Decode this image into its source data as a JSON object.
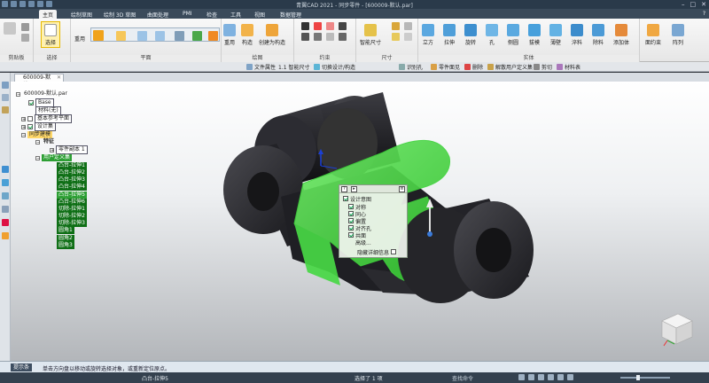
{
  "window": {
    "title": "青翼CAD 2021 - 同步零件 - [600009-默认.par]"
  },
  "menu": {
    "tabs": [
      "主页",
      "绘制草图",
      "绘制 3D 草图",
      "曲面处理",
      "PMI",
      "检查",
      "工具",
      "视图",
      "数据管理"
    ],
    "active_index": 0
  },
  "ribbon": {
    "groups": {
      "clipboard": "剪贴板",
      "select": "选择",
      "plane": "平面",
      "sketch": "绘图",
      "relate": "约束",
      "dimension": "尺寸",
      "solid": "实体"
    },
    "buttons": {
      "select": "选择",
      "reuse": "重用",
      "draw": "构造",
      "create_construct": "创建为构造",
      "smart_dim": "智能尺寸",
      "cube": "立方",
      "extrude": "拉伸",
      "revolve": "旋转",
      "hole": "孔",
      "sidewall": "侧圆",
      "thin": "拔模",
      "thinwall": "薄壁",
      "chamfer": "淬料",
      "remove": "除料",
      "add_body": "添加体",
      "face_relate": "面约束",
      "array": "阵列"
    }
  },
  "commandbar": {
    "items": [
      "文件属性",
      "1.1 智能尺寸",
      "切换设计/构造",
      "识别孔",
      "零件面见",
      "删除",
      "解散用户定义集",
      "剪切",
      "材料表"
    ]
  },
  "document": {
    "tab_label": "600009-默认.par"
  },
  "tree": {
    "root": "600009-默认.par",
    "items": [
      {
        "label": "Base",
        "style": "box",
        "check": true
      },
      {
        "label": "材料(无)",
        "style": "box",
        "check": false
      },
      {
        "label": "基本参考平面",
        "style": "box",
        "check": false
      },
      {
        "label": "设计集",
        "style": "box",
        "check": true
      },
      {
        "label": "同步建模",
        "style": "hy",
        "check": false
      },
      {
        "label": "特征",
        "style": "plain",
        "check": false
      },
      {
        "label": "零件副本 1",
        "style": "plain",
        "check": false
      },
      {
        "label": "用户定义集",
        "style": "hl2",
        "check": false
      },
      {
        "label": "凸台-拉伸1",
        "style": "hl",
        "check": false
      },
      {
        "label": "凸台-拉伸2",
        "style": "hl",
        "check": false
      },
      {
        "label": "凸台-拉伸3",
        "style": "hl",
        "check": false
      },
      {
        "label": "凸台-拉伸4",
        "style": "hl",
        "check": false
      },
      {
        "label": "凸台-拉伸5",
        "style": "hl2",
        "check": false
      },
      {
        "label": "凸台-拉伸6",
        "style": "hl",
        "check": false
      },
      {
        "label": "切除-拉伸1",
        "style": "hl",
        "check": false
      },
      {
        "label": "切除-拉伸2",
        "style": "hl",
        "check": false
      },
      {
        "label": "切除-拉伸3",
        "style": "hl",
        "check": false
      },
      {
        "label": "圆角1",
        "style": "hl",
        "check": false
      },
      {
        "label": "圆角2",
        "style": "hl",
        "check": false
      },
      {
        "label": "圆角3",
        "style": "hl",
        "check": false
      }
    ]
  },
  "popup": {
    "title": "设计意图",
    "items": [
      {
        "label": "对称",
        "checked": true
      },
      {
        "label": "同心",
        "checked": true
      },
      {
        "label": "偏置",
        "checked": true
      },
      {
        "label": "对齐孔",
        "checked": true
      },
      {
        "label": "共面",
        "checked": true
      },
      {
        "label": "高级...",
        "checked": false
      }
    ],
    "footer": "隐藏详细信息"
  },
  "prompt": {
    "label": "提示条",
    "text": "单击方向盘以移动或旋转选择对象，或重新定位原点。"
  },
  "status": {
    "feature": "凸台-拉伸5",
    "selection": "选择了 1 项",
    "find": "查找命令"
  },
  "colors": {
    "accent_green": "#3fd33c",
    "title_bg": "#2a3a4a",
    "status_bg": "#34414f"
  }
}
